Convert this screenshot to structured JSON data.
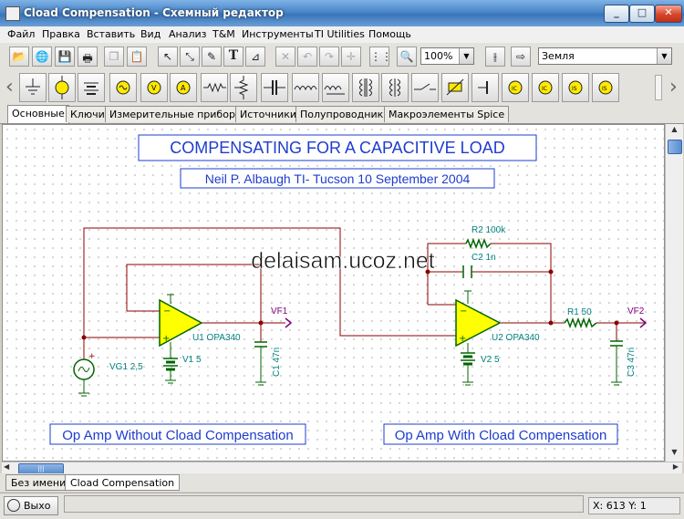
{
  "window": {
    "title": "Cload Compensation - Схемный редактор",
    "minimize_label": "_",
    "maximize_label": "□",
    "close_label": "✕"
  },
  "menu": {
    "items": [
      {
        "label": "Файл"
      },
      {
        "label": "Правка"
      },
      {
        "label": "Вставить"
      },
      {
        "label": "Вид"
      },
      {
        "label": "Анализ"
      },
      {
        "label": "T&M"
      },
      {
        "label": "Инструменты"
      },
      {
        "label": "TI Utilities"
      },
      {
        "label": "Помощь"
      }
    ]
  },
  "toolbar": {
    "zoom_value": "100%",
    "ground_value": "Земля",
    "text_tool_glyph": "T"
  },
  "component_tabs": [
    {
      "label": "Основные"
    },
    {
      "label": "Ключи"
    },
    {
      "label": "Измерительные приборы"
    },
    {
      "label": "Источники"
    },
    {
      "label": "Полупроводники"
    },
    {
      "label": "Макроэлементы Spice"
    }
  ],
  "schematic": {
    "title": "COMPENSATING FOR A CAPACITIVE LOAD",
    "subtitle": "Neil P. Albaugh  TI- Tucson  10 September 2004",
    "watermark": "delaisam.ucoz.net",
    "caption_left": "Op Amp Without Cload Compensation",
    "caption_right": "Op Amp With Cload Compensation",
    "labels": {
      "u1": "U1 OPA340",
      "u2": "U2 OPA340",
      "vf1": "VF1",
      "vf2": "VF2",
      "v1": "V1 5",
      "v2": "V2 5",
      "vg1": "VG1 2,5",
      "c1": "C1 47n",
      "c3": "C3 47n",
      "r2": "R2 100k",
      "c2": "C2 1n",
      "r1": "R1 50"
    },
    "colors": {
      "wire": "#8b0000",
      "component": "#006400",
      "label": "#008080",
      "opamp_fill": "#ffff00",
      "title_text": "#1e3ccf",
      "probe": "#800080"
    }
  },
  "bottom_tabs": [
    {
      "label": "Без имени"
    },
    {
      "label": "Cload Compensation"
    }
  ],
  "status": {
    "exit_label": "Выхо",
    "coordinates": "X: 613  Y: 1"
  }
}
